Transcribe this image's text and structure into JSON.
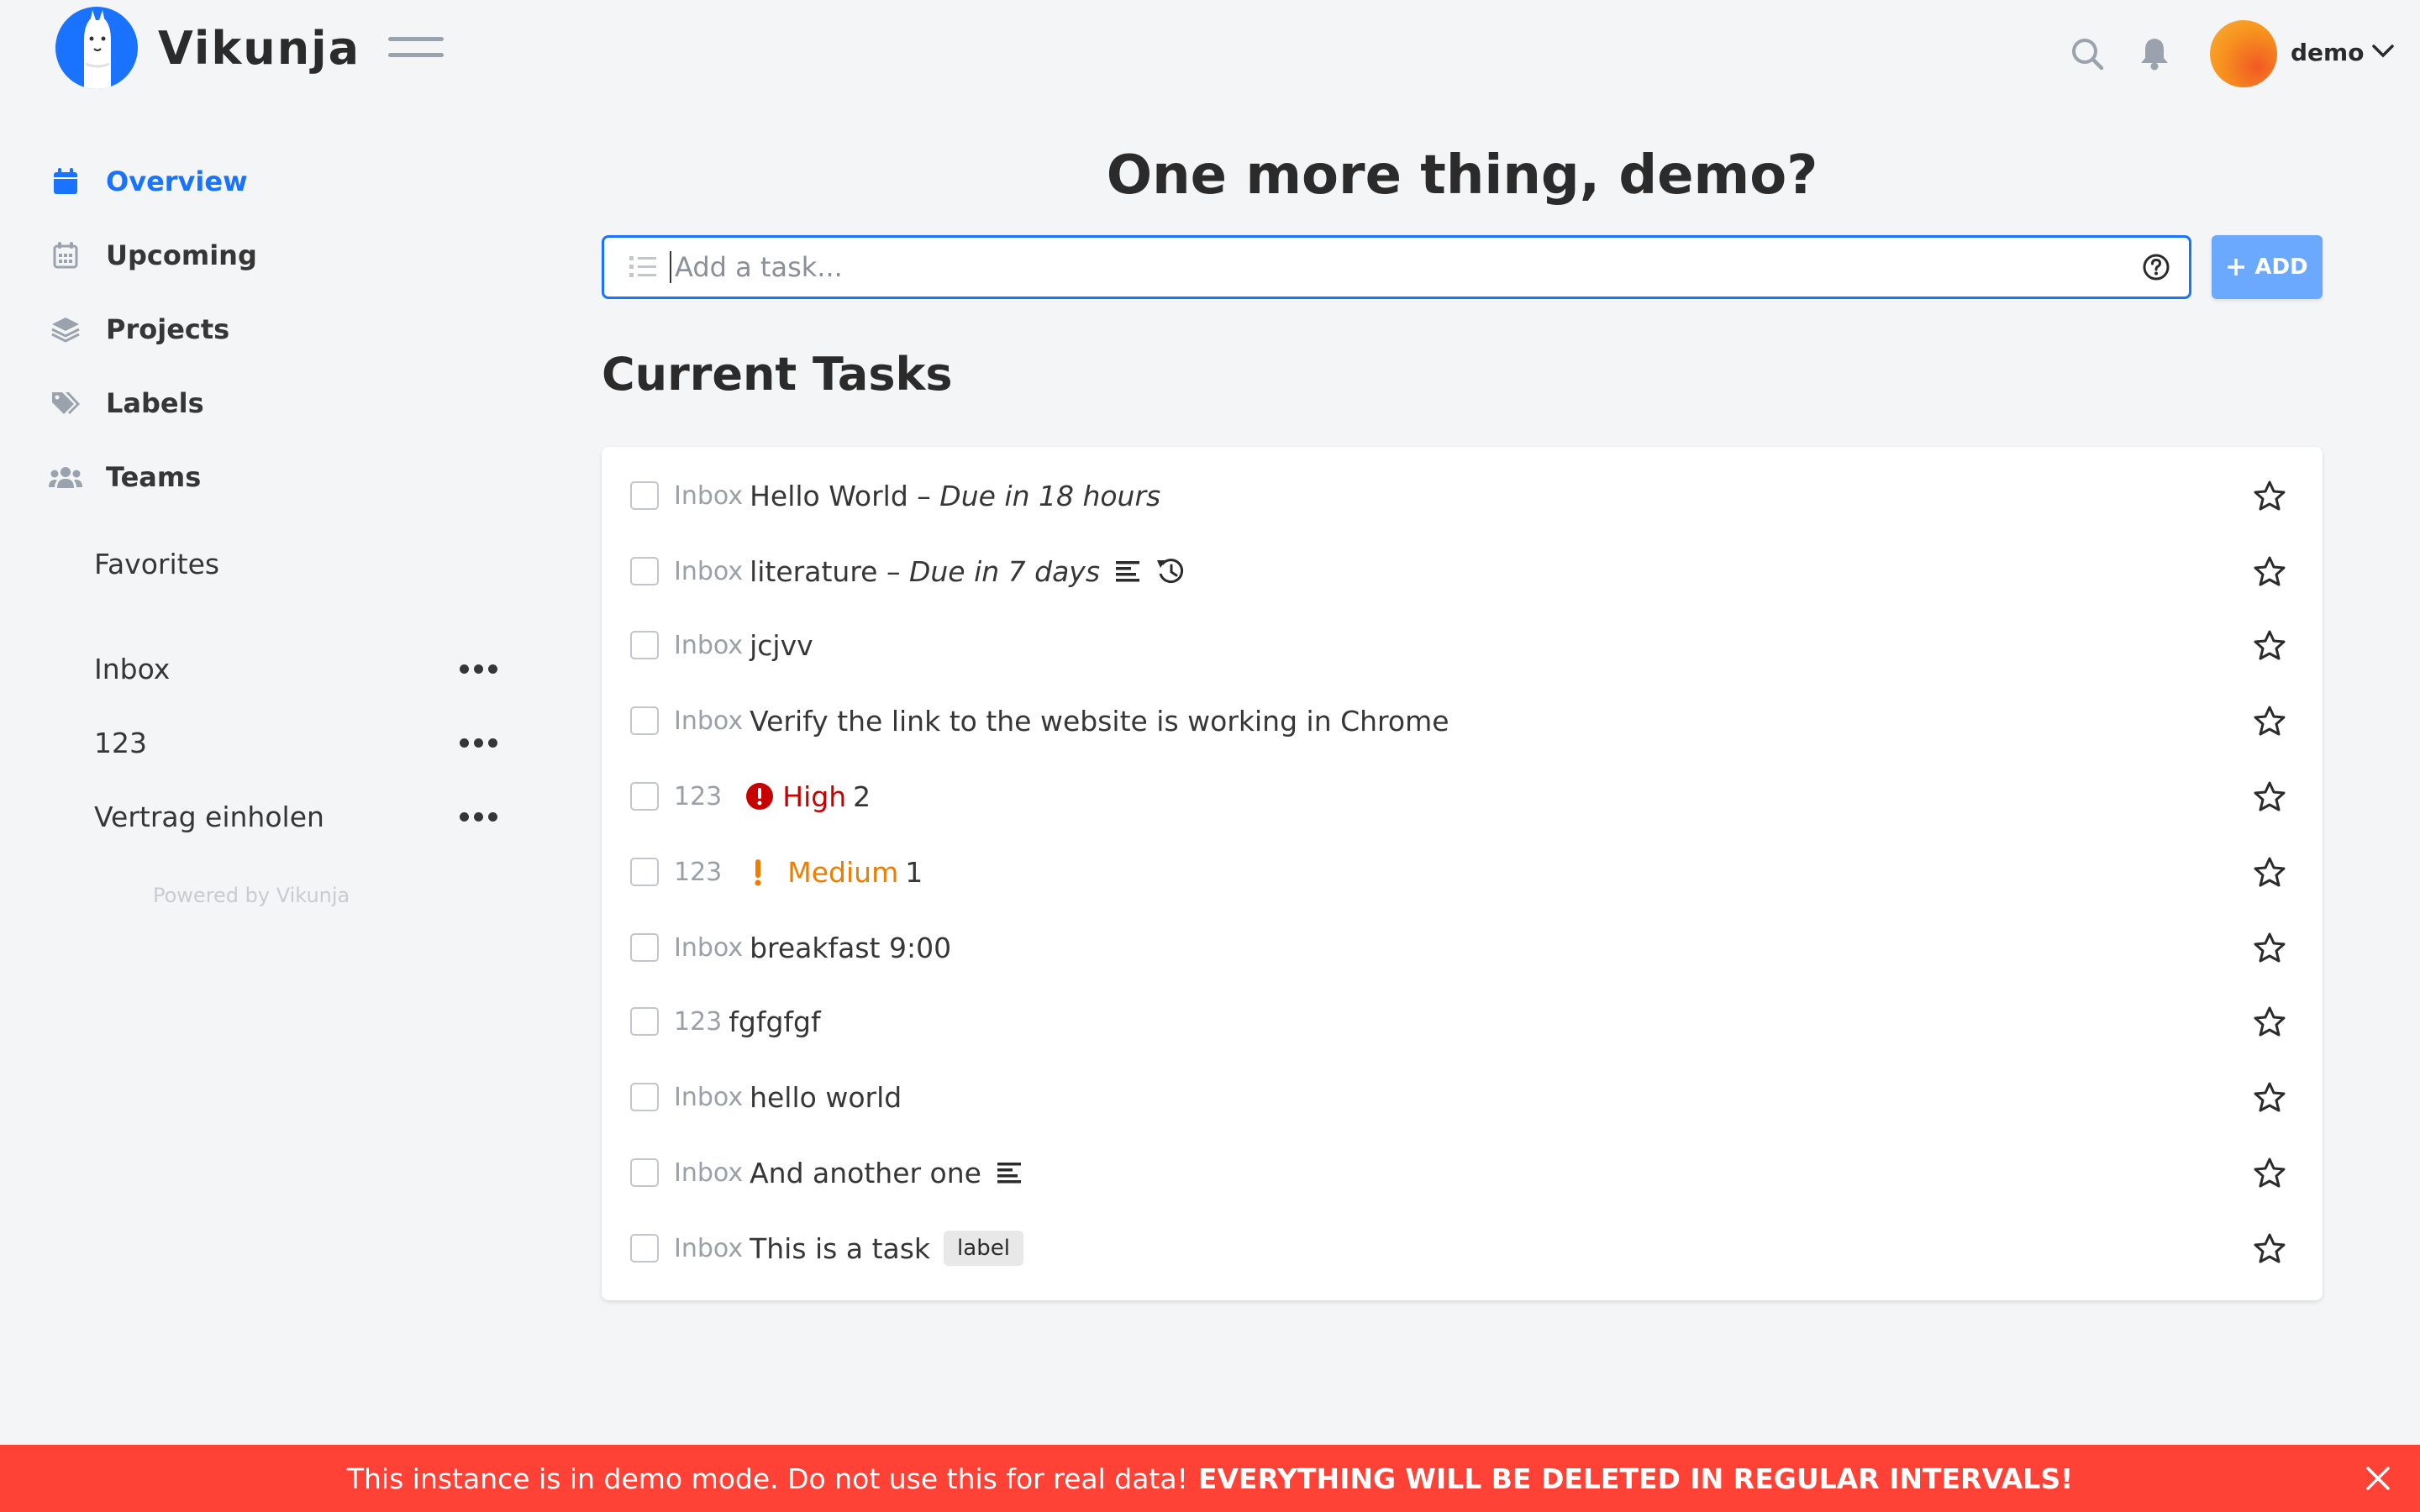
{
  "app": {
    "name": "Vikunja"
  },
  "header": {
    "username": "demo",
    "icons": {
      "menu": "hamburger-icon",
      "search": "search-icon",
      "notifications": "bell-icon",
      "user_menu": "chevron-down-icon"
    }
  },
  "sidebar": {
    "nav": [
      {
        "label": "Overview",
        "icon": "calendar-icon",
        "active": true
      },
      {
        "label": "Upcoming",
        "icon": "calendar-grid-icon",
        "active": false
      },
      {
        "label": "Projects",
        "icon": "layers-icon",
        "active": false
      },
      {
        "label": "Labels",
        "icon": "tags-icon",
        "active": false
      },
      {
        "label": "Teams",
        "icon": "users-icon",
        "active": false
      }
    ],
    "favorites_label": "Favorites",
    "projects": [
      {
        "name": "Inbox"
      },
      {
        "name": "123"
      },
      {
        "name": "Vertrag einholen"
      }
    ],
    "powered_by": "Powered by Vikunja"
  },
  "main": {
    "greeting": "One more thing, demo?",
    "add_task": {
      "placeholder": "Add a task...",
      "button_label": "ADD"
    },
    "section_title": "Current Tasks",
    "tasks": [
      {
        "project": "Inbox",
        "title": "Hello World",
        "due": "Due in 18 hours"
      },
      {
        "project": "Inbox",
        "title": "literature",
        "due": "Due in 7 days",
        "has_description": true,
        "repeating": true
      },
      {
        "project": "Inbox",
        "title": "jcjvv"
      },
      {
        "project": "Inbox",
        "title": "Verify the link to the website is working in Chrome"
      },
      {
        "project": "123",
        "priority": "High",
        "title": "2"
      },
      {
        "project": "123",
        "priority": "Medium",
        "title": "1"
      },
      {
        "project": "Inbox",
        "title": "breakfast 9:00"
      },
      {
        "project": "123",
        "title": "fgfgfgf"
      },
      {
        "project": "Inbox",
        "title": "hello world"
      },
      {
        "project": "Inbox",
        "title": "And another one",
        "has_description": true
      },
      {
        "project": "Inbox",
        "title": "This is a task",
        "label": "label"
      }
    ]
  },
  "banner": {
    "text": "This instance is in demo mode. Do not use this for real data!",
    "emphasis": "EVERYTHING WILL BE DELETED IN REGULAR INTERVALS!"
  },
  "colors": {
    "primary": "#1973ff",
    "background": "#f4f5f7",
    "priority_high": "#c70000",
    "priority_medium": "#ef7d00",
    "banner": "#ff4136"
  }
}
